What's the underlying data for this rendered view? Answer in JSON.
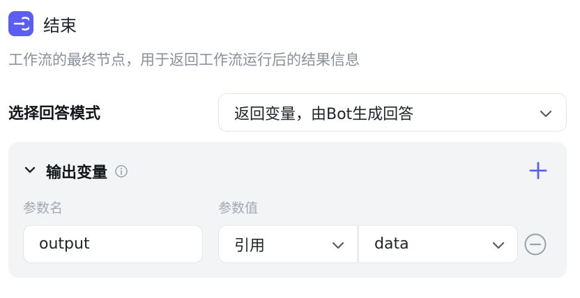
{
  "header": {
    "title": "结束",
    "icon": "exit-node-icon",
    "accent": "#5b5ef0"
  },
  "description": "工作流的最终节点，用于返回工作流运行后的结果信息",
  "answer_mode": {
    "label": "选择回答模式",
    "selected": "返回变量，由Bot生成回答"
  },
  "output_section": {
    "title": "输出变量",
    "columns": {
      "name": "参数名",
      "value": "参数值"
    },
    "rows": [
      {
        "name": "output",
        "value_source": "引用",
        "value_ref": "data"
      }
    ]
  }
}
